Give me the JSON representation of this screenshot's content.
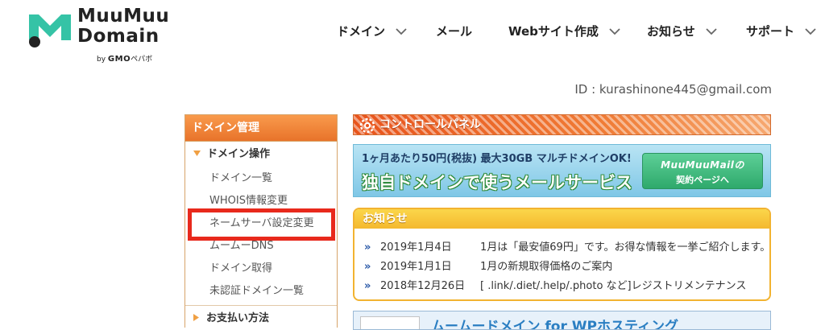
{
  "header": {
    "logo": {
      "line1": "MuuMuu",
      "line2": "Domain",
      "by": "by",
      "gmo": "GMO",
      "pepabo": "ペパボ"
    },
    "nav": [
      {
        "label": "ドメイン",
        "has_dropdown": true
      },
      {
        "label": "メール",
        "has_dropdown": false
      },
      {
        "label": "Webサイト作成",
        "has_dropdown": true
      },
      {
        "label": "お知らせ",
        "has_dropdown": true
      },
      {
        "label": "サポート",
        "has_dropdown": true
      }
    ]
  },
  "user": {
    "id_text": "ID : kurashinone445@gmail.com"
  },
  "sidebar": {
    "title": "ドメイン管理",
    "section1": {
      "label": "ドメイン操作"
    },
    "items": [
      "ドメイン一覧",
      "WHOIS情報変更",
      "ネームサーバ設定変更",
      "ムームーDNS",
      "ドメイン取得",
      "未認証ドメイン一覧"
    ],
    "section2": {
      "label": "お支払い方法"
    }
  },
  "control_panel": {
    "title": "コントロールパネル"
  },
  "mail_banner": {
    "line1": "1ヶ月あたり50円(税抜) 最大30GB マルチドメインOK!",
    "line2": "独自ドメインで使うメールサービス",
    "button_line1": "MuuMuuMailの",
    "button_line2": "契約ページへ"
  },
  "news": {
    "title": "お知らせ",
    "items": [
      {
        "date": "2019年1月4日",
        "text": "1月は「最安値69円」です。お得な情報を一挙ご紹介します。"
      },
      {
        "date": "2019年1月1日",
        "text": "1月の新規取得価格のご案内"
      },
      {
        "date": "2018年12月26日",
        "text": "[ .link/.diet/.help/.photo など]レジストリメンテナンス"
      }
    ]
  },
  "bottom_banner": {
    "text": "ムームードメイン for WPホスティング"
  },
  "colors": {
    "accent_orange": "#e8732a",
    "highlight_red": "#e8291c",
    "news_yellow": "#f4b82e",
    "mail_green": "#2ea96c",
    "logo_teal": "#35c3a6"
  }
}
